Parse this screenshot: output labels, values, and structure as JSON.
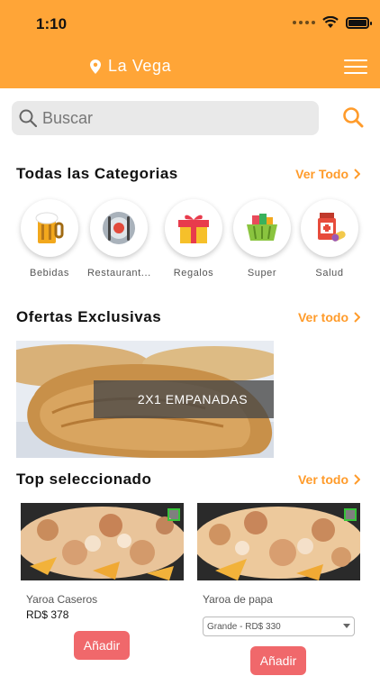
{
  "status_bar": {
    "time": "1:10"
  },
  "header": {
    "location": "La Vega"
  },
  "search": {
    "placeholder": "Buscar"
  },
  "categories_section": {
    "title": "Todas las Categorias",
    "see_all": "Ver Todo",
    "items": [
      {
        "label": "Bebidas",
        "icon": "beer-icon"
      },
      {
        "label": "Restaurant...",
        "icon": "plate-icon"
      },
      {
        "label": "Regalos",
        "icon": "gift-icon"
      },
      {
        "label": "Super",
        "icon": "basket-icon"
      },
      {
        "label": "Salud",
        "icon": "medicine-icon"
      }
    ]
  },
  "offers_section": {
    "title": "Ofertas Exclusivas",
    "see_all": "Ver todo",
    "banner": "2X1 EMPANADAS"
  },
  "top_section": {
    "title": "Top seleccionado",
    "see_all": "Ver todo",
    "products": [
      {
        "name": "Yaroa Caseros",
        "price": "RD$ 378",
        "button": "Añadir"
      },
      {
        "name": "Yaroa de papa",
        "size_option": "Grande - RD$ 330",
        "button": "Añadir"
      }
    ]
  },
  "colors": {
    "accent": "#ffa537",
    "link": "#ff9b2a",
    "add_button": "#f0686b"
  }
}
